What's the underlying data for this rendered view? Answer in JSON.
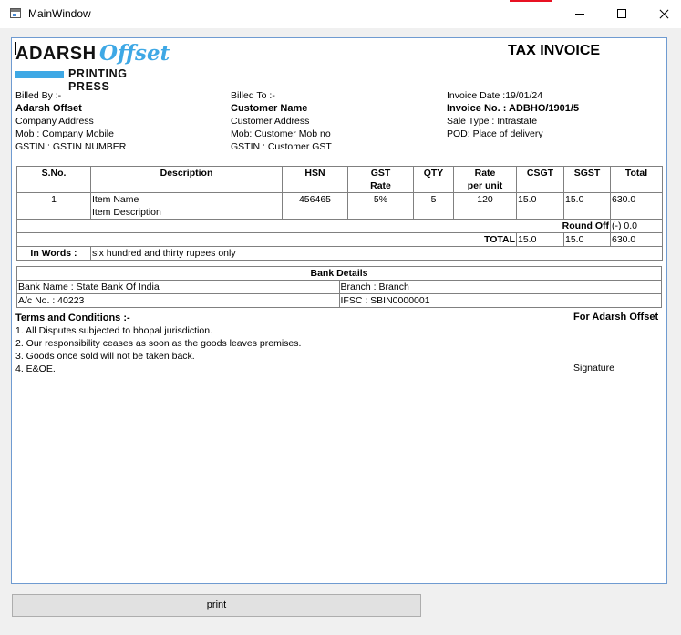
{
  "window": {
    "title": "MainWindow"
  },
  "header": {
    "logo_adarsh": "ADARSH",
    "logo_offset": "Offset",
    "logo_press": "PRINTING PRESS",
    "doc_title": "TAX INVOICE"
  },
  "billed_by": {
    "label": "Billed By :-",
    "name": "Adarsh Offset",
    "address": "Company Address",
    "mob": "Mob : Company Mobile",
    "gstin": "GSTIN : GSTIN NUMBER"
  },
  "billed_to": {
    "label": "Billed To :-",
    "name": "Customer Name",
    "address": "Customer Address",
    "mob": "Mob: Customer Mob no",
    "gstin": "GSTIN : Customer GST"
  },
  "invoice": {
    "date": "Invoice Date :19/01/24",
    "number": "Invoice No. : ADBHO/1901/5",
    "sale_type": "Sale Type : Intrastate",
    "pod": "POD: Place of delivery"
  },
  "items_table": {
    "headers": {
      "sno": "S.No.",
      "description": "Description",
      "hsn": "HSN",
      "gst_rate_1": "GST",
      "gst_rate_2": "Rate",
      "qty": "QTY",
      "rate_1": "Rate",
      "rate_2": "per unit",
      "csgt": "CSGT",
      "sgst": "SGST",
      "total": "Total"
    },
    "rows": [
      {
        "sno": "1",
        "item_name": "Item Name",
        "item_description": "Item Description",
        "hsn": "456465",
        "gst_rate": "5%",
        "qty": "5",
        "rate": "120",
        "csgt": "15.0",
        "sgst": "15.0",
        "total": "630.0"
      }
    ],
    "round_off_label": "Round Off",
    "round_off_value": "(-) 0.0",
    "total_label": "TOTAL",
    "total_csgt": "15.0",
    "total_sgst": "15.0",
    "total_value": "630.0",
    "in_words_label": "In Words :",
    "in_words_value": "six hundred and thirty rupees only"
  },
  "bank": {
    "title": "Bank Details",
    "bank_name": "Bank Name : State Bank Of India",
    "branch": "Branch : Branch",
    "account": "A/c No. : 40223",
    "ifsc": "IFSC : SBIN0000001"
  },
  "terms": {
    "heading": "Terms and Conditions :-",
    "items": [
      "1. All Disputes subjected to bhopal jurisdiction.",
      "2. Our responsibility ceases as soon as the goods leaves premises.",
      "3. Goods once sold will not be taken back.",
      "4. E&OE."
    ],
    "for_company": "For Adarsh Offset",
    "signature": "Signature"
  },
  "actions": {
    "print_label": "print"
  },
  "colors": {
    "brand_blue": "#3ea8e5",
    "frame_border": "#6f9bd1"
  }
}
